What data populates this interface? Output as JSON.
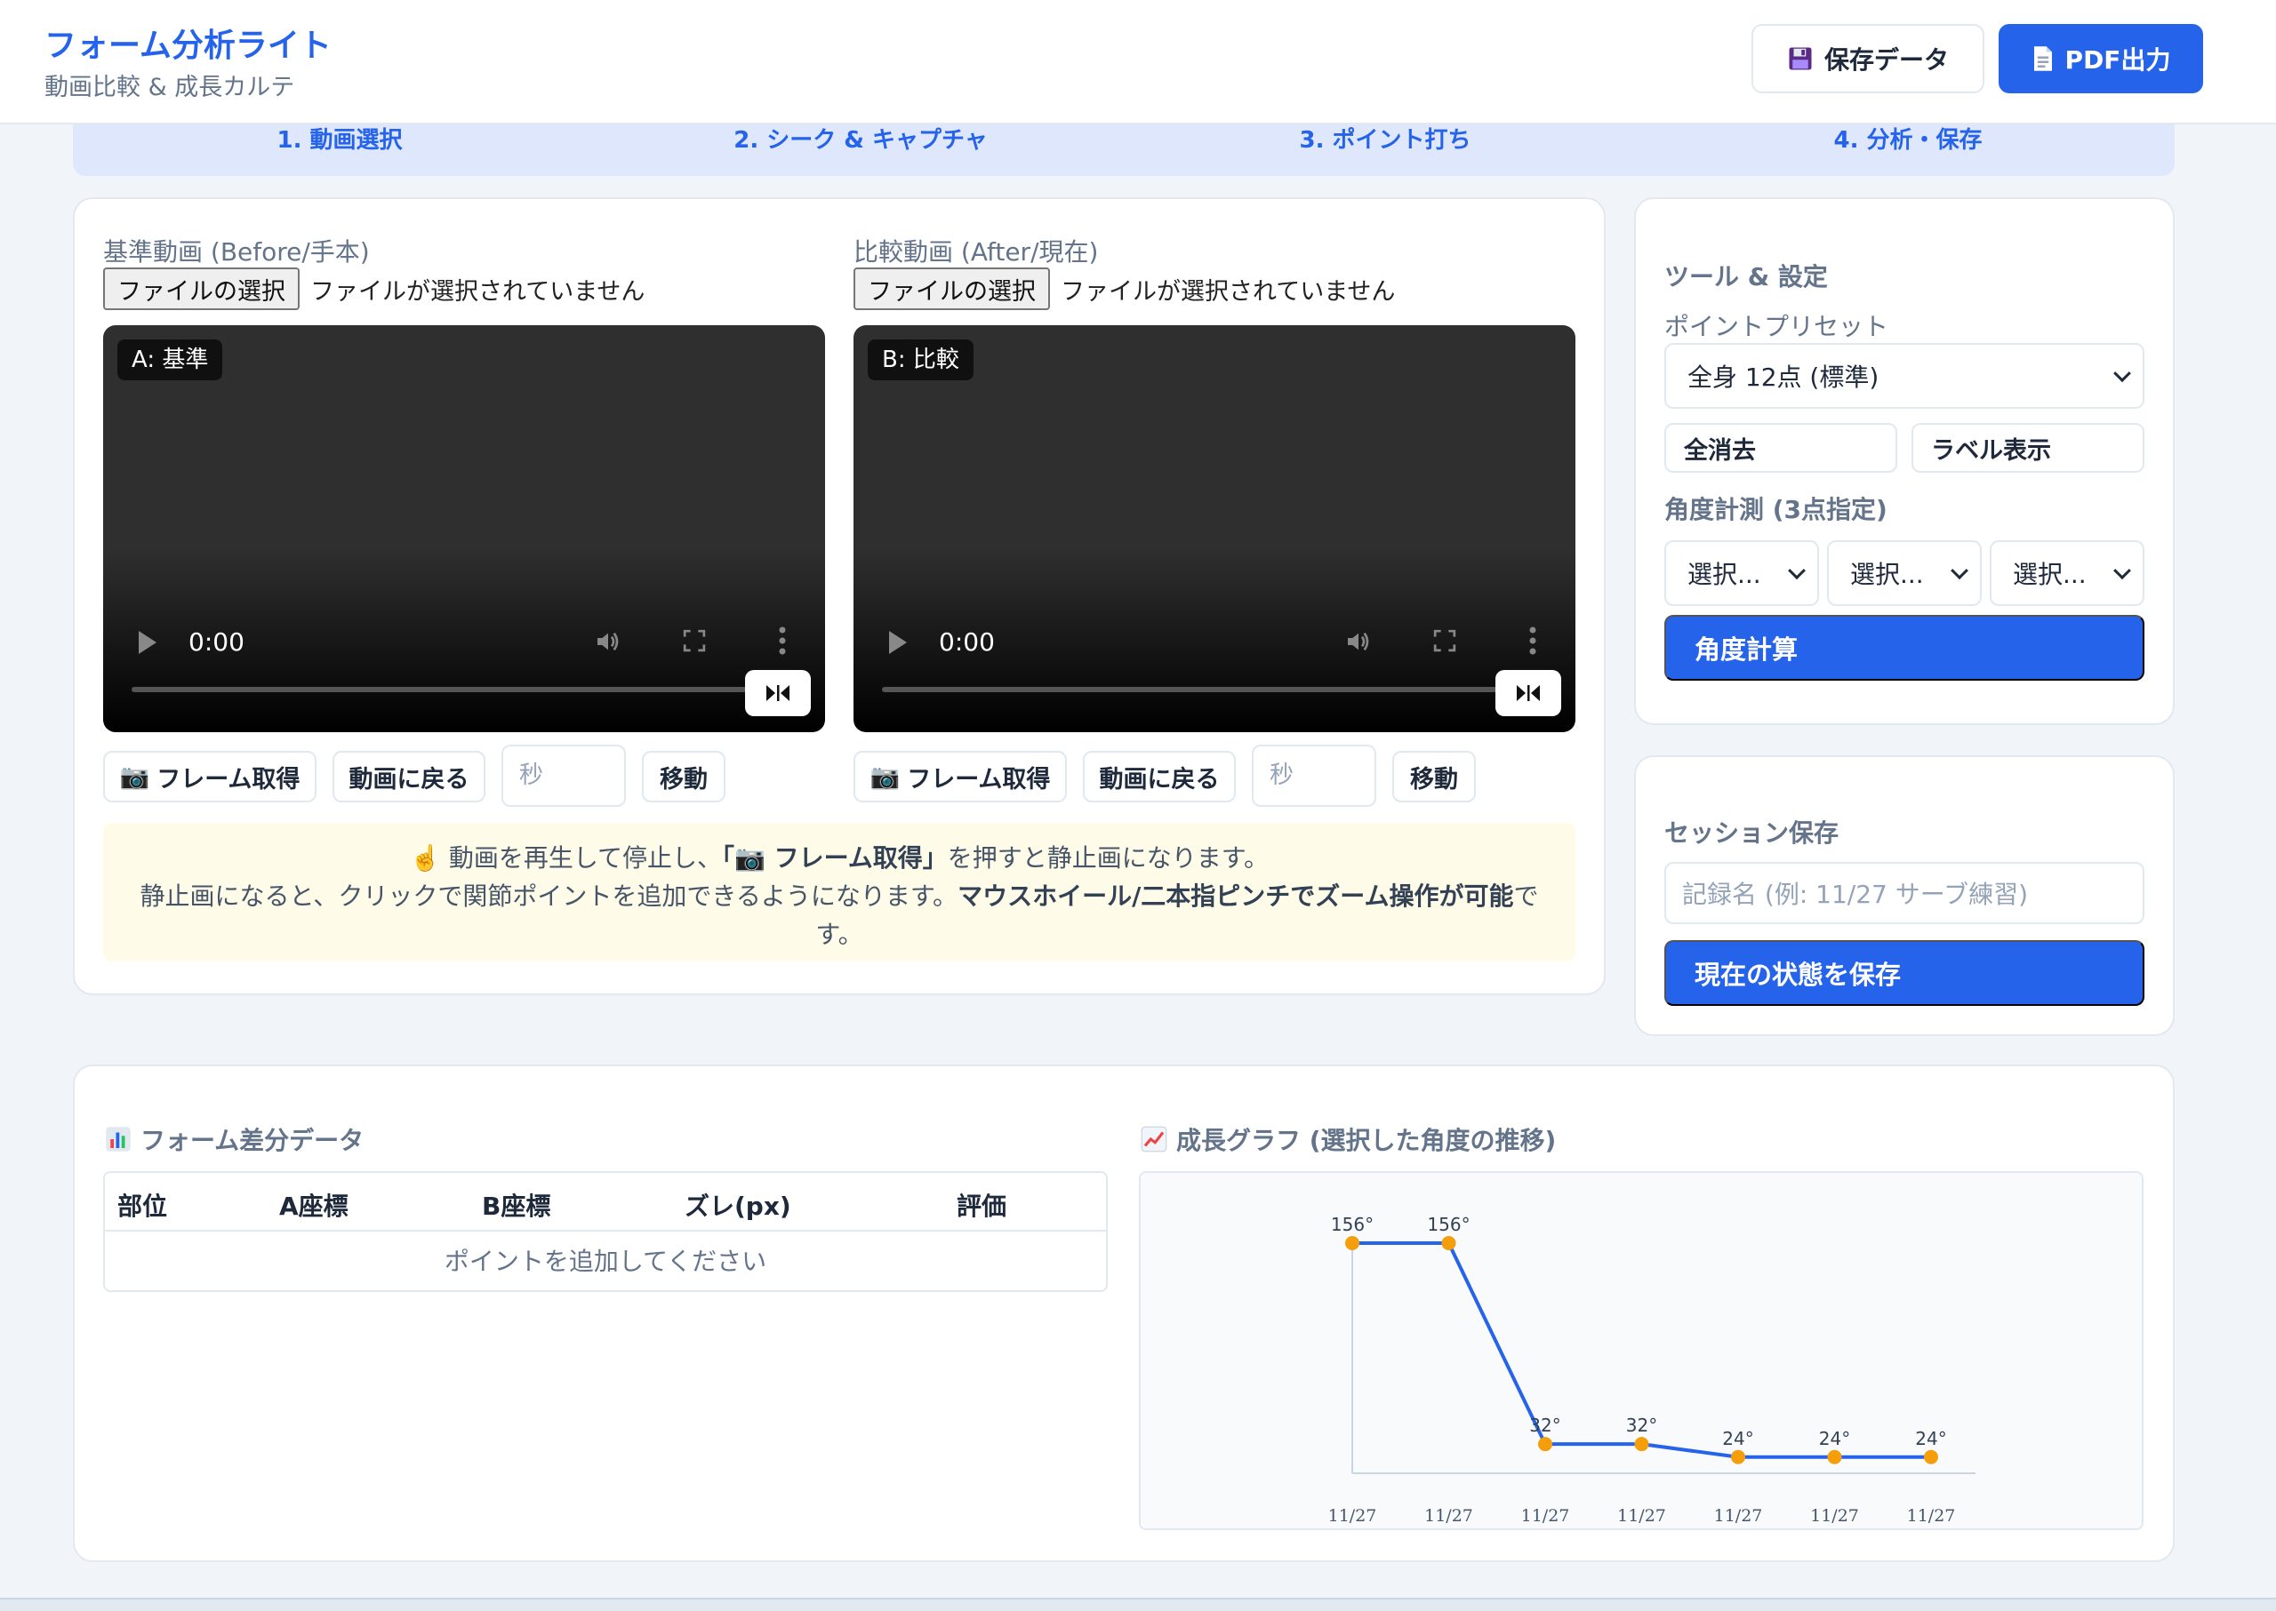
{
  "header": {
    "title": "フォーム分析ライト",
    "subtitle": "動画比較 & 成長カルテ",
    "save_data_label": "保存データ",
    "pdf_label": "PDF出力"
  },
  "steps": [
    "1. 動画選択",
    "2. シーク & キャプチャ",
    "3. ポイント打ち",
    "4. 分析・保存"
  ],
  "videos": {
    "a": {
      "label": "基準動画 (Before/手本)",
      "file_button": "ファイルの選択",
      "file_status": "ファイルが選択されていません",
      "tag": "A: 基準",
      "time": "0:00",
      "capture_label": "フレーム取得",
      "back_label": "動画に戻る",
      "seconds_placeholder": "秒",
      "move_label": "移動"
    },
    "b": {
      "label": "比較動画 (After/現在)",
      "file_button": "ファイルの選択",
      "file_status": "ファイルが選択されていません",
      "tag": "B: 比較",
      "time": "0:00",
      "capture_label": "フレーム取得",
      "back_label": "動画に戻る",
      "seconds_placeholder": "秒",
      "move_label": "移動"
    }
  },
  "notice": {
    "line1_pre": "動画を再生して停止し、",
    "line1_bold": "「📷 フレーム取得」",
    "line1_post": "を押すと静止画になります。",
    "line2_pre": "静止画になると、クリックで関節ポイントを追加できるようになります。",
    "line2_bold": "マウスホイール/二本指ピンチでズーム操作が可能",
    "line2_post": "で",
    "line3": "す。"
  },
  "tools": {
    "title": "ツール & 設定",
    "preset_label": "ポイントプリセット",
    "preset_value": "全身 12点 (標準)",
    "clear_label": "全消去",
    "label_toggle": "ラベル表示",
    "angle_title": "角度計測 (3点指定)",
    "angle_selects": [
      "選択...",
      "選択...",
      "選択..."
    ],
    "calc_label": "角度計算"
  },
  "session": {
    "title": "セッション保存",
    "name_placeholder": "記録名 (例: 11/27 サーブ練習)",
    "save_label": "現在の状態を保存"
  },
  "diff": {
    "title": "フォーム差分データ",
    "columns": [
      "部位",
      "A座標",
      "B座標",
      "ズレ(px)",
      "評価"
    ],
    "empty": "ポイントを追加してください"
  },
  "growth": {
    "title": "成長グラフ (選択した角度の推移)"
  },
  "chart_data": {
    "type": "line",
    "categories": [
      "11/27",
      "11/27",
      "11/27",
      "11/27",
      "11/27",
      "11/27",
      "11/27"
    ],
    "values": [
      156,
      156,
      32,
      32,
      24,
      24,
      24
    ],
    "data_labels": [
      "156°",
      "156°",
      "32°",
      "32°",
      "24°",
      "24°",
      "24°"
    ],
    "title": "",
    "xlabel": "",
    "ylabel": "",
    "ylim": [
      14,
      156
    ],
    "grid": false,
    "line_color": "#2563eb",
    "point_color": "#f59e0b"
  }
}
